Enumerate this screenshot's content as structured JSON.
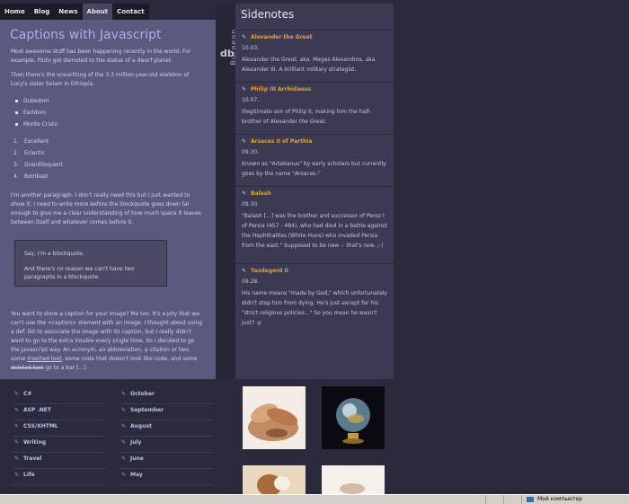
{
  "nav": {
    "items": [
      {
        "label": "Home"
      },
      {
        "label": "Blog"
      },
      {
        "label": "News"
      },
      {
        "label": "About"
      },
      {
        "label": "Contact"
      }
    ]
  },
  "main": {
    "title": "Captions with Javascript",
    "p1": "Most awesome stuff has been happening recently in the world. For example, Pluto got demoted to the status of a dwarf planet.",
    "p2": "Then there's the unearthing of the 3.3 million-year-old skeleton of Lucy's sister Selam in Ethiopia.",
    "bullets": [
      "Dukedom",
      "Earldom",
      "Monte Cristo"
    ],
    "ordered": [
      {
        "n": "1.",
        "label": "Excellent"
      },
      {
        "n": "2.",
        "label": "Eclectic"
      },
      {
        "n": "3.",
        "label": "Grandiloquent"
      },
      {
        "n": "4.",
        "label": "Bombast"
      }
    ],
    "p3": "I'm another paragraph. I don't really need this but I just wanted to show it. I need to write more before the blockquote goes down far enough to give me a clear understanding of how much space it leaves between itself and whatever comes before it.",
    "blockquote": {
      "b1": "Say, I'm a blockquote.",
      "b2": "And there's no reason we can't have two paragraphs in a blockquote."
    },
    "p4_a": "You want to show a caption for your image? Me too. It's a pity that we can't use the <caption> element with an image. I thought about using a def. list to associate the image with its caption, but I really didn't want to go to the extra trouble every single time. So I decided to go the Javascript way. An acronym, an abbreviation, a citation or two, some ",
    "p4_ins": "inserted text",
    "p4_b": ", some code that doesn't look like code, and some ",
    "p4_del": "deleted text",
    "p4_c": " go to a bar [...]"
  },
  "brand": {
    "text": "Burgeon",
    "mark": "db"
  },
  "sidenotes": {
    "title": "Sidenotes",
    "notes": [
      {
        "title": "Alexander the Great",
        "date": "10.03.",
        "body": "Alexander the Great, aka. Megas Alexandros, aka. Alexander III. A brilliant military strategist."
      },
      {
        "title": "Philip III Arrhidaeus",
        "date": "10.07.",
        "body": "Illegitimate son of Philip II, making him the half-brother of Alexander the Great."
      },
      {
        "title": "Arsaces II of Parthia",
        "date": "09.30.",
        "body": "Known as \"Artabanus\" by early scholars but currently goes by the name \"Arsaces.\""
      },
      {
        "title": "Balash",
        "date": "09.30.",
        "body": "\"Balash [...] was the brother and successor of Peroz I of Persia (457 - 484), who had died in a battle against the Hephthalites (White Huns) who invaded Persia from the east.\" Supposed to be new -- that's new. ;-)"
      },
      {
        "title": "Yazdegerd II",
        "date": "09.28.",
        "body": "His name means \"made by God,\" which unfortunately didn't stop him from dying. He's just except for his \"strict religious policies...\" So you mean he wasn't just? :p"
      }
    ]
  },
  "categories": {
    "col1": [
      "C#",
      "ASP .NET",
      "CSS/XHTML",
      "Writing",
      "Travel",
      "Life"
    ],
    "col2": [
      "October",
      "September",
      "August",
      "July",
      "June",
      "May"
    ]
  },
  "status": {
    "zone": "Мой компьютер"
  },
  "colors": {
    "accent": "#e2a23a",
    "main_bg": "#5a5a7e",
    "side_bg": "#3a3a52",
    "title": "#aab0e6"
  }
}
